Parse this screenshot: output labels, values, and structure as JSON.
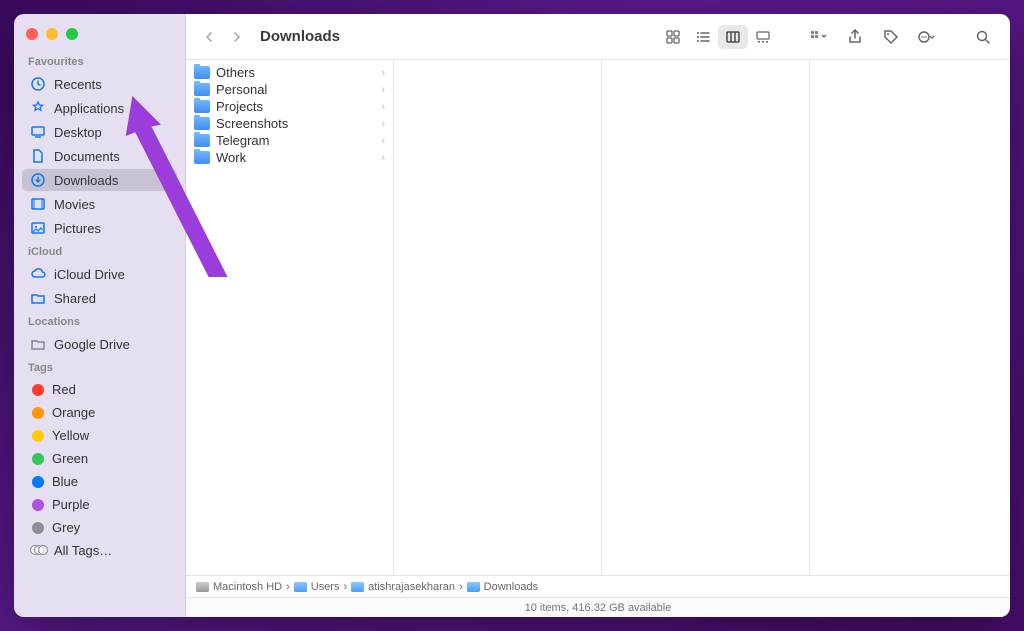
{
  "window": {
    "title": "Downloads"
  },
  "sidebar": {
    "sections": [
      {
        "label": "Favourites",
        "items": [
          {
            "icon": "clock-icon",
            "label": "Recents"
          },
          {
            "icon": "app-icon",
            "label": "Applications"
          },
          {
            "icon": "desktop-icon",
            "label": "Desktop"
          },
          {
            "icon": "doc-icon",
            "label": "Documents"
          },
          {
            "icon": "download-icon",
            "label": "Downloads",
            "selected": true
          },
          {
            "icon": "movie-icon",
            "label": "Movies"
          },
          {
            "icon": "picture-icon",
            "label": "Pictures"
          }
        ]
      },
      {
        "label": "iCloud",
        "items": [
          {
            "icon": "cloud-icon",
            "label": "iCloud Drive"
          },
          {
            "icon": "shared-icon",
            "label": "Shared"
          }
        ]
      },
      {
        "label": "Locations",
        "items": [
          {
            "icon": "drive-icon",
            "label": "Google Drive"
          }
        ]
      },
      {
        "label": "Tags",
        "items": [
          {
            "tag": "#ff3b30",
            "label": "Red"
          },
          {
            "tag": "#ff9500",
            "label": "Orange"
          },
          {
            "tag": "#ffcc00",
            "label": "Yellow"
          },
          {
            "tag": "#34c759",
            "label": "Green"
          },
          {
            "tag": "#007aff",
            "label": "Blue"
          },
          {
            "tag": "#af52de",
            "label": "Purple"
          },
          {
            "tag": "#8e8e93",
            "label": "Grey"
          },
          {
            "alltags": true,
            "label": "All Tags…"
          }
        ]
      }
    ]
  },
  "folders": [
    {
      "name": "Others"
    },
    {
      "name": "Personal"
    },
    {
      "name": "Projects"
    },
    {
      "name": "Screenshots"
    },
    {
      "name": "Telegram"
    },
    {
      "name": "Work"
    }
  ],
  "path": [
    {
      "icon": "hd",
      "label": "Macintosh HD"
    },
    {
      "icon": "folder",
      "label": "Users"
    },
    {
      "icon": "folder",
      "label": "atishrajasekharan"
    },
    {
      "icon": "folder",
      "label": "Downloads"
    }
  ],
  "status": {
    "text": "10 items, 416.32 GB available"
  },
  "toolbar": {
    "view_modes": [
      "icon",
      "list",
      "column",
      "gallery"
    ],
    "active_view": "column"
  }
}
